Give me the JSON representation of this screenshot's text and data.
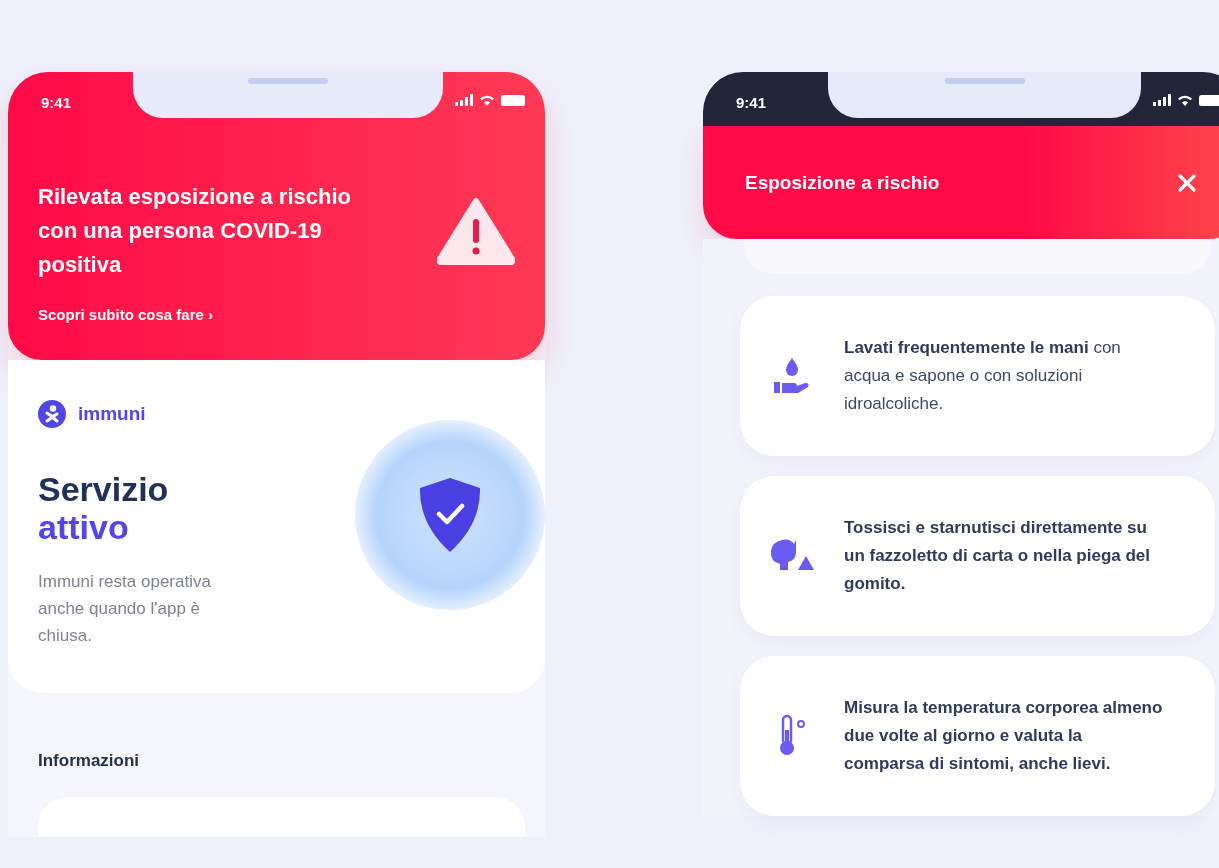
{
  "home_screen": {
    "status": {
      "time": "9:41"
    },
    "alert": {
      "title": "Rilevata esposizione a rischio con una persona COVID-19 positiva",
      "link": "Scopri subito cosa fare ›"
    },
    "brand": "immuni",
    "service": {
      "line1": "Servizio",
      "line2": "attivo",
      "description": "Immuni resta operativa anche quando l'app è chiusa."
    },
    "section_title": "Informazioni"
  },
  "exposure_screen": {
    "status": {
      "time": "9:41"
    },
    "title": "Esposizione a rischio",
    "tips": [
      {
        "kind": "handwash",
        "bold": false,
        "text": "**Lavati frequentemente le mani** con acqua e sapone o con soluzioni idroalcoliche."
      },
      {
        "kind": "cough",
        "bold": true,
        "text": "Tossisci e starnutisci direttamente su un fazzoletto di carta o nella piega del gomito."
      },
      {
        "kind": "thermometer",
        "bold": true,
        "text": "Misura la temperatura corporea almeno due volte al giorno e valuta la comparsa di sintomi, anche lievi."
      }
    ]
  }
}
